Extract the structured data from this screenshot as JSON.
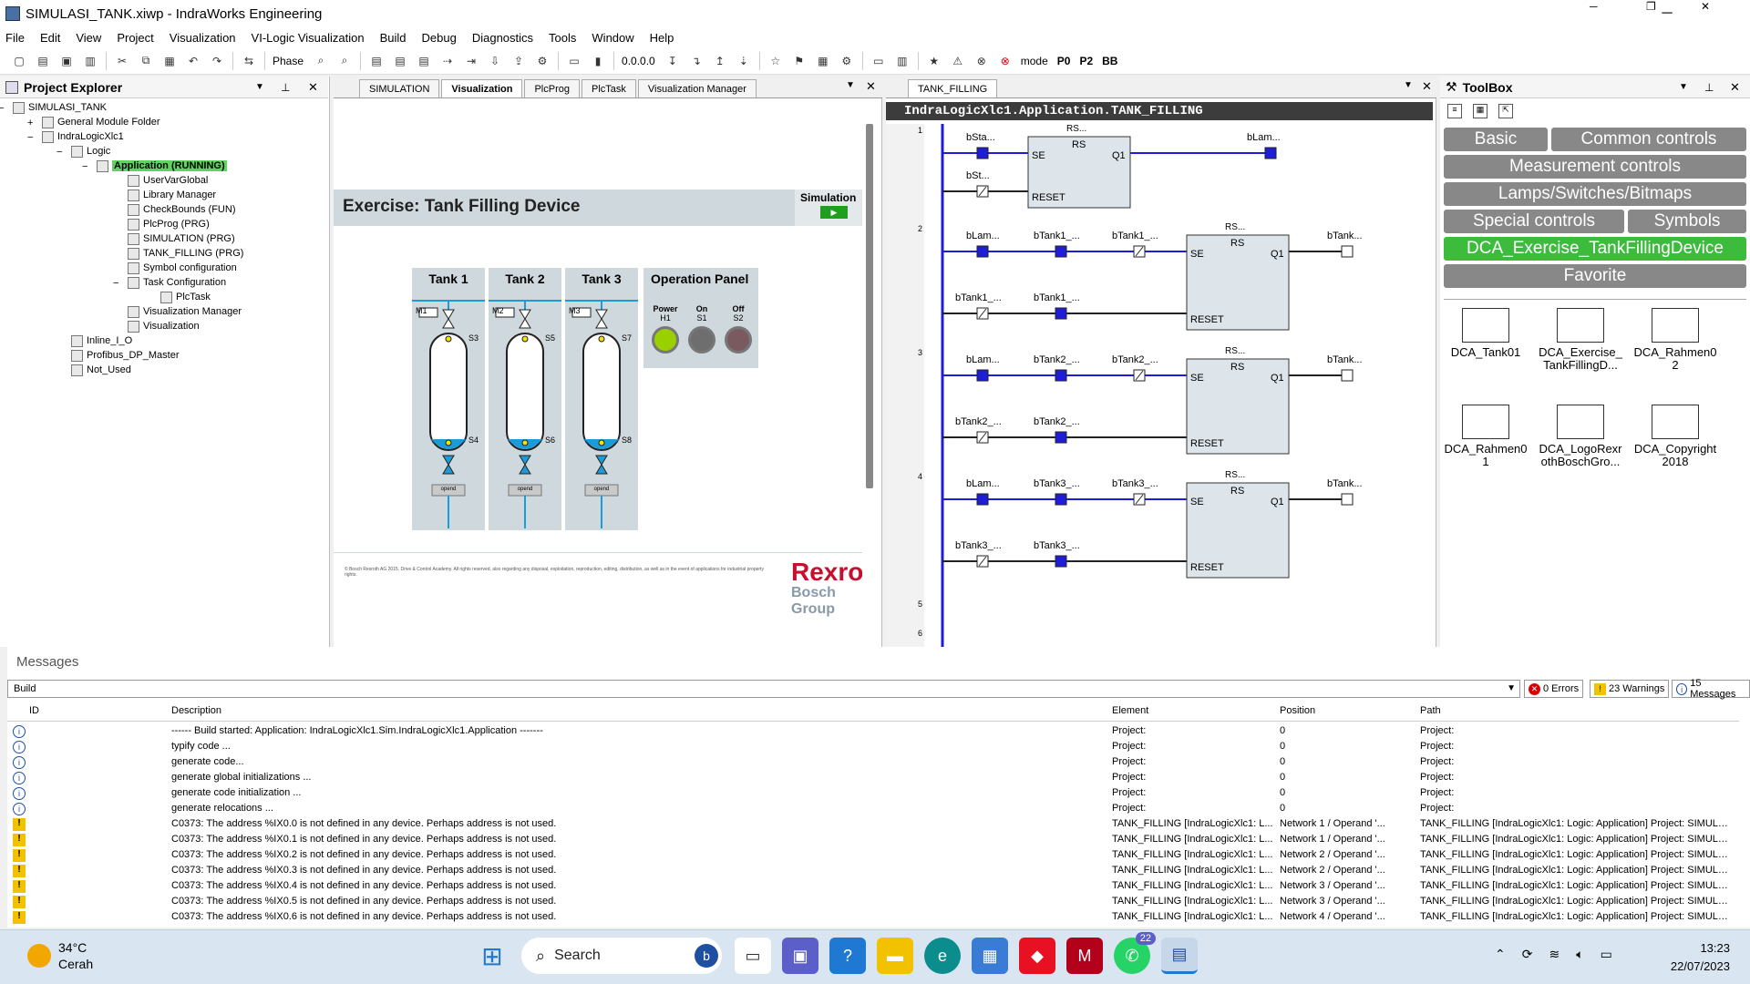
{
  "window": {
    "title": "SIMULASI_TANK.xiwp - IndraWorks Engineering",
    "minimize": "─",
    "maximize": "❐",
    "close": "✕"
  },
  "menu": [
    "File",
    "Edit",
    "View",
    "Project",
    "Visualization",
    "VI-Logic Visualization",
    "Build",
    "Debug",
    "Diagnostics",
    "Tools",
    "Window",
    "Help"
  ],
  "toolbar": {
    "phase": "Phase",
    "version": "0.0.0.0",
    "mode": "mode",
    "p0": "P0",
    "p2": "P2",
    "bb": "BB"
  },
  "project_explorer": {
    "title": "Project Explorer",
    "nodes": [
      "SIMULASI_TANK",
      "General Module Folder",
      "IndraLogicXlc1",
      "Logic",
      "Application (RUNNING)",
      "UserVarGlobal",
      "Library Manager",
      "CheckBounds (FUN)",
      "PlcProg (PRG)",
      "SIMULATION (PRG)",
      "TANK_FILLING (PRG)",
      "Symbol configuration",
      "Task Configuration",
      "PlcTask",
      "Visualization Manager",
      "Visualization",
      "Inline_I_O",
      "Profibus_DP_Master",
      "Not_Used"
    ]
  },
  "viz": {
    "tabs": [
      "SIMULATION",
      "Visualization",
      "PlcProg",
      "PlcTask",
      "Visualization Manager"
    ],
    "active_tab": "Visualization",
    "title": "Exercise: Tank Filling Device",
    "sim_label": "Simulation",
    "sim_btn": "▶",
    "tanks": [
      {
        "name": "Tank 1",
        "motor": "M1",
        "top": "S3",
        "bottom": "S4",
        "btn": "opend"
      },
      {
        "name": "Tank 2",
        "motor": "M2",
        "top": "S5",
        "bottom": "S6",
        "btn": "opend"
      },
      {
        "name": "Tank 3",
        "motor": "M3",
        "top": "S7",
        "bottom": "S8",
        "btn": "opend"
      }
    ],
    "operation_panel": {
      "title": "Operation Panel",
      "lamps": [
        {
          "label": "Power",
          "sub": "H1",
          "color": "#9ad000"
        },
        {
          "label": "On",
          "sub": "S1",
          "color": "#6e6e6e"
        },
        {
          "label": "Off",
          "sub": "S2",
          "color": "#7a5a5f"
        }
      ]
    },
    "copyright": "© Bosch Rexroth AG 2015. Drive & Control Academy. All rights reserved, also regarding any disposal, exploitation, reproduction, editing, distribution, as well as in the event of applications for industrial property rights.",
    "brand": "Rexroth",
    "brand_sub": "Bosch Group"
  },
  "ladder": {
    "tab": "TANK_FILLING",
    "path": "IndraLogicXlc1.Application.TANK_FILLING",
    "rows": [
      "1",
      "2",
      "3",
      "4",
      "5",
      "6"
    ],
    "rs_label": "RS...",
    "rs": "RS",
    "se": "SE",
    "reset": "RESET",
    "q1": "Q1",
    "net1": {
      "c1": "bSta...",
      "c2": "bSt...",
      "out": "bLam..."
    },
    "net2": {
      "a": "bLam...",
      "b": "bTank1_...",
      "c": "bTank1_...",
      "d": "bTank1_...",
      "e": "bTank1_...",
      "out": "bTank..."
    },
    "net3": {
      "a": "bLam...",
      "b": "bTank2_...",
      "c": "bTank2_...",
      "d": "bTank2_...",
      "e": "bTank2_...",
      "out": "bTank..."
    },
    "net4": {
      "a": "bLam...",
      "b": "bTank3_...",
      "c": "bTank3_...",
      "d": "bTank3_...",
      "e": "bTank3_...",
      "out": "bTank..."
    }
  },
  "toolbox": {
    "title": "ToolBox",
    "buttons": [
      "Basic",
      "Common controls",
      "Measurement controls",
      "Lamps/Switches/Bitmaps",
      "Special controls",
      "Symbols",
      "DCA_Exercise_TankFillingDevice",
      "Favorite"
    ],
    "items": [
      "DCA_Tank01",
      "DCA_Exercise_TankFillingD...",
      "DCA_Rahmen02",
      "DCA_Rahmen01",
      "DCA_LogoRexrothBoschGro...",
      "DCA_Copyright2018"
    ]
  },
  "messages": {
    "title": "Messages",
    "filter": "Build",
    "errors": "0 Errors",
    "warnings": "23 Warnings",
    "infos": "15 Messages",
    "columns": [
      "ID",
      "Description",
      "Element",
      "Position",
      "Path"
    ],
    "rows": [
      {
        "t": "i",
        "desc": "------ Build started: Application: IndraLogicXlc1.Sim.IndraLogicXlc1.Application -------",
        "el": "Project:",
        "pos": "0",
        "path": "Project:"
      },
      {
        "t": "i",
        "desc": "typify code ...",
        "el": "Project:",
        "pos": "0",
        "path": "Project:"
      },
      {
        "t": "i",
        "desc": "generate code...",
        "el": "Project:",
        "pos": "0",
        "path": "Project:"
      },
      {
        "t": "i",
        "desc": "generate global initializations ...",
        "el": "Project:",
        "pos": "0",
        "path": "Project:"
      },
      {
        "t": "i",
        "desc": "generate code initialization ...",
        "el": "Project:",
        "pos": "0",
        "path": "Project:"
      },
      {
        "t": "i",
        "desc": "generate relocations ...",
        "el": "Project:",
        "pos": "0",
        "path": "Project:"
      },
      {
        "t": "w",
        "desc": "C0373:  The address %IX0.0 is not defined in any device. Perhaps address is not used.",
        "el": "TANK_FILLING [IndraLogicXlc1: L...",
        "pos": "Network 1 / Operand '...",
        "path": "TANK_FILLING [IndraLogicXlc1: Logic: Application] Project: SIMULASI_T..."
      },
      {
        "t": "w",
        "desc": "C0373:  The address %IX0.1 is not defined in any device. Perhaps address is not used.",
        "el": "TANK_FILLING [IndraLogicXlc1: L...",
        "pos": "Network 1 / Operand '...",
        "path": "TANK_FILLING [IndraLogicXlc1: Logic: Application] Project: SIMULASI_T..."
      },
      {
        "t": "w",
        "desc": "C0373:  The address %IX0.2 is not defined in any device. Perhaps address is not used.",
        "el": "TANK_FILLING [IndraLogicXlc1: L...",
        "pos": "Network 2 / Operand '...",
        "path": "TANK_FILLING [IndraLogicXlc1: Logic: Application] Project: SIMULASI_T..."
      },
      {
        "t": "w",
        "desc": "C0373:  The address %IX0.3 is not defined in any device. Perhaps address is not used.",
        "el": "TANK_FILLING [IndraLogicXlc1: L...",
        "pos": "Network 2 / Operand '...",
        "path": "TANK_FILLING [IndraLogicXlc1: Logic: Application] Project: SIMULASI_T..."
      },
      {
        "t": "w",
        "desc": "C0373:  The address %IX0.4 is not defined in any device. Perhaps address is not used.",
        "el": "TANK_FILLING [IndraLogicXlc1: L...",
        "pos": "Network 3 / Operand '...",
        "path": "TANK_FILLING [IndraLogicXlc1: Logic: Application] Project: SIMULASI_T..."
      },
      {
        "t": "w",
        "desc": "C0373:  The address %IX0.5 is not defined in any device. Perhaps address is not used.",
        "el": "TANK_FILLING [IndraLogicXlc1: L...",
        "pos": "Network 3 / Operand '...",
        "path": "TANK_FILLING [IndraLogicXlc1: Logic: Application] Project: SIMULASI_T..."
      },
      {
        "t": "w",
        "desc": "C0373:  The address %IX0.6 is not defined in any device. Perhaps address is not used.",
        "el": "TANK_FILLING [IndraLogicXlc1: L...",
        "pos": "Network 4 / Operand '...",
        "path": "TANK_FILLING [IndraLogicXlc1: Logic: Application] Project: SIMULASI_T..."
      }
    ]
  },
  "taskbar": {
    "temp": "34°C",
    "weather": "Cerah",
    "search": "Search",
    "badge": "22",
    "time": "13:23",
    "date": "22/07/2023"
  }
}
